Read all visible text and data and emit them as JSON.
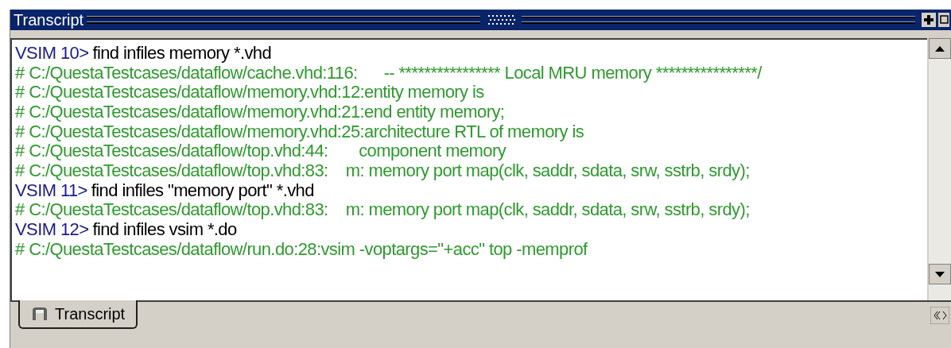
{
  "window": {
    "title": "Transcript"
  },
  "lines": [
    {
      "kind": "prompt",
      "prompt": "VSIM 10>",
      "text": "find infiles memory *.vhd"
    },
    {
      "kind": "output",
      "text": "# C:/QuestaTestcases/dataflow/cache.vhd:116:      -- **************** Local MRU memory ****************/"
    },
    {
      "kind": "output",
      "text": "# C:/QuestaTestcases/dataflow/memory.vhd:12:entity memory is"
    },
    {
      "kind": "output",
      "text": "# C:/QuestaTestcases/dataflow/memory.vhd:21:end entity memory;"
    },
    {
      "kind": "output",
      "text": "# C:/QuestaTestcases/dataflow/memory.vhd:25:architecture RTL of memory is"
    },
    {
      "kind": "output",
      "text": "# C:/QuestaTestcases/dataflow/top.vhd:44:       component memory"
    },
    {
      "kind": "output",
      "text": "# C:/QuestaTestcases/dataflow/top.vhd:83:    m: memory port map(clk, saddr, sdata, srw, sstrb, srdy);"
    },
    {
      "kind": "prompt",
      "prompt": "VSIM 11>",
      "text": "find infiles \"memory port\" *.vhd"
    },
    {
      "kind": "output",
      "text": "# C:/QuestaTestcases/dataflow/top.vhd:83:    m: memory port map(clk, saddr, sdata, srw, sstrb, srdy);"
    },
    {
      "kind": "prompt",
      "prompt": "VSIM 12>",
      "text": "find infiles vsim *.do"
    },
    {
      "kind": "output",
      "text": "# C:/QuestaTestcases/dataflow/run.do:28:vsim -voptargs=\"+acc\" top -memprof"
    }
  ],
  "tabs": [
    {
      "label": "Transcript",
      "selected": true
    }
  ]
}
